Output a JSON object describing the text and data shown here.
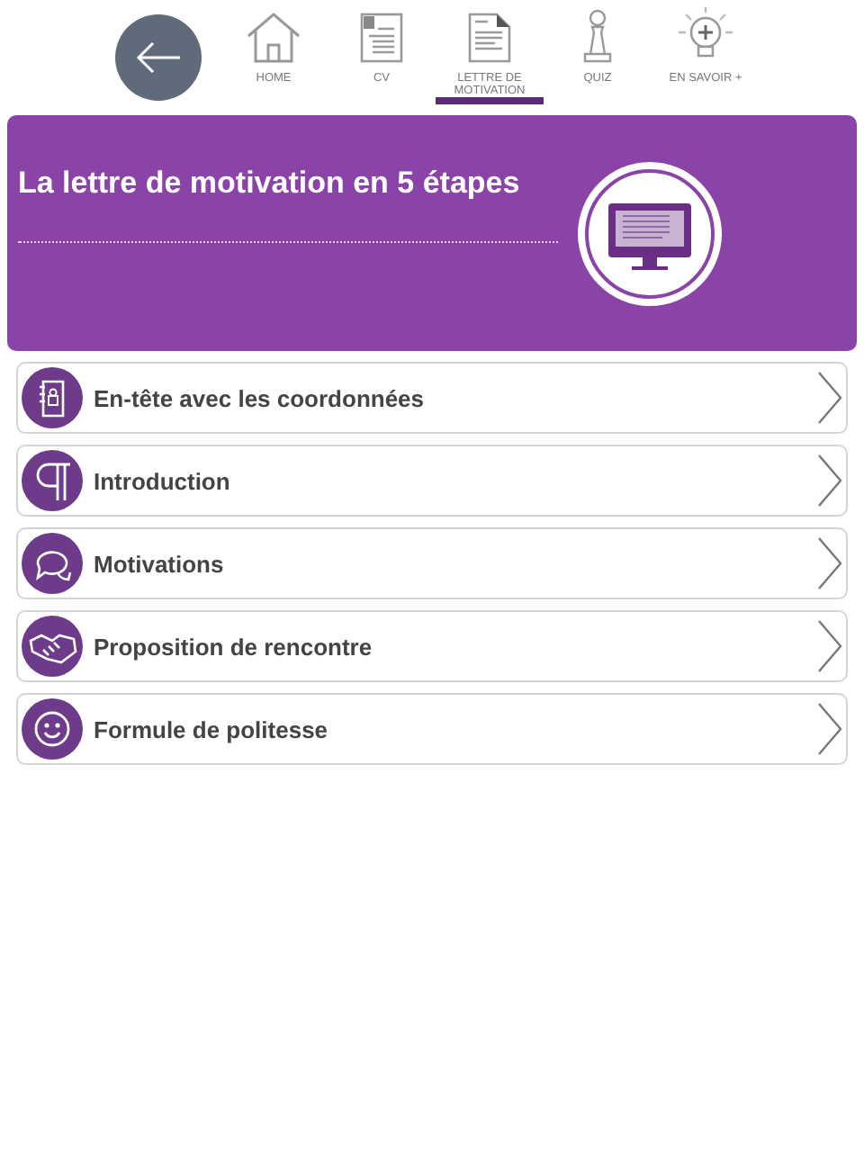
{
  "nav": [
    {
      "label": "HOME",
      "selected": false
    },
    {
      "label": "CV",
      "selected": false
    },
    {
      "label": "LETTRE DE MOTIVATION",
      "selected": true
    },
    {
      "label": "QUIZ",
      "selected": false
    },
    {
      "label": "EN SAVOIR +",
      "selected": false
    }
  ],
  "banner": {
    "title": "La lettre de motivation en 5 étapes"
  },
  "steps": [
    {
      "label": "En-tête avec les coordonnées"
    },
    {
      "label": "Introduction"
    },
    {
      "label": "Motivations"
    },
    {
      "label": "Proposition de rencontre"
    },
    {
      "label": "Formule de politesse"
    }
  ]
}
